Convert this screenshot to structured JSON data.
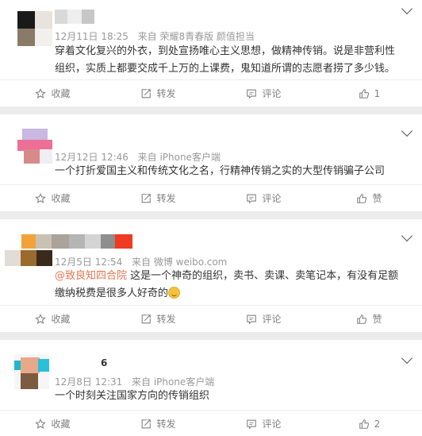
{
  "icons": {
    "favorite": "star-outline-icon",
    "repost": "share-arrow-icon",
    "comment": "comment-bubble-icon",
    "like": "thumb-up-icon",
    "expand": "chevron-down-icon"
  },
  "colors": {
    "mention": "#eb7350",
    "meta": "#999999",
    "action": "#808080",
    "background": "#ececec"
  },
  "posts": [
    {
      "time": "12月11日 18:25",
      "source_prefix": "来自",
      "source": "荣耀8青春版 颜值担当",
      "text": "穿着文化复兴的外衣，到处宣扬唯心主义思想，做精神传销。说是非营利性组织，实质上都要交成千上万的上课费，鬼知道所谓的志愿者捞了多少钱。",
      "actions": {
        "favorite": "收藏",
        "repost": "转发",
        "comment": "评论",
        "like": "1"
      }
    },
    {
      "time": "12月12日 12:46",
      "source_prefix": "来自",
      "source": "iPhone客户端",
      "text": "一个打折爱国主义和传统文化之名，行精神传销之实的大型传销骗子公司",
      "actions": {
        "favorite": "收藏",
        "repost": "转发",
        "comment": "评论",
        "like": "赞"
      }
    },
    {
      "time": "12月5日 12:54",
      "source_prefix": "来自",
      "source": "微博 weibo.com",
      "mention": "@致良知四合院",
      "text": " 这是一个神奇的组织，卖书、卖课、卖笔记本，有没有足额缴纳税费是很多人好奇的",
      "actions": {
        "favorite": "收藏",
        "repost": "转发",
        "comment": "评论",
        "like": "赞"
      }
    },
    {
      "name_fragment": "6",
      "time": "12月8日 12:31",
      "source_prefix": "来自",
      "source": "iPhone客户端",
      "text": "一个时刻关注国家方向的传销组织",
      "actions": {
        "favorite": "收藏",
        "repost": "转发",
        "comment": "评论",
        "like": "2"
      }
    }
  ]
}
